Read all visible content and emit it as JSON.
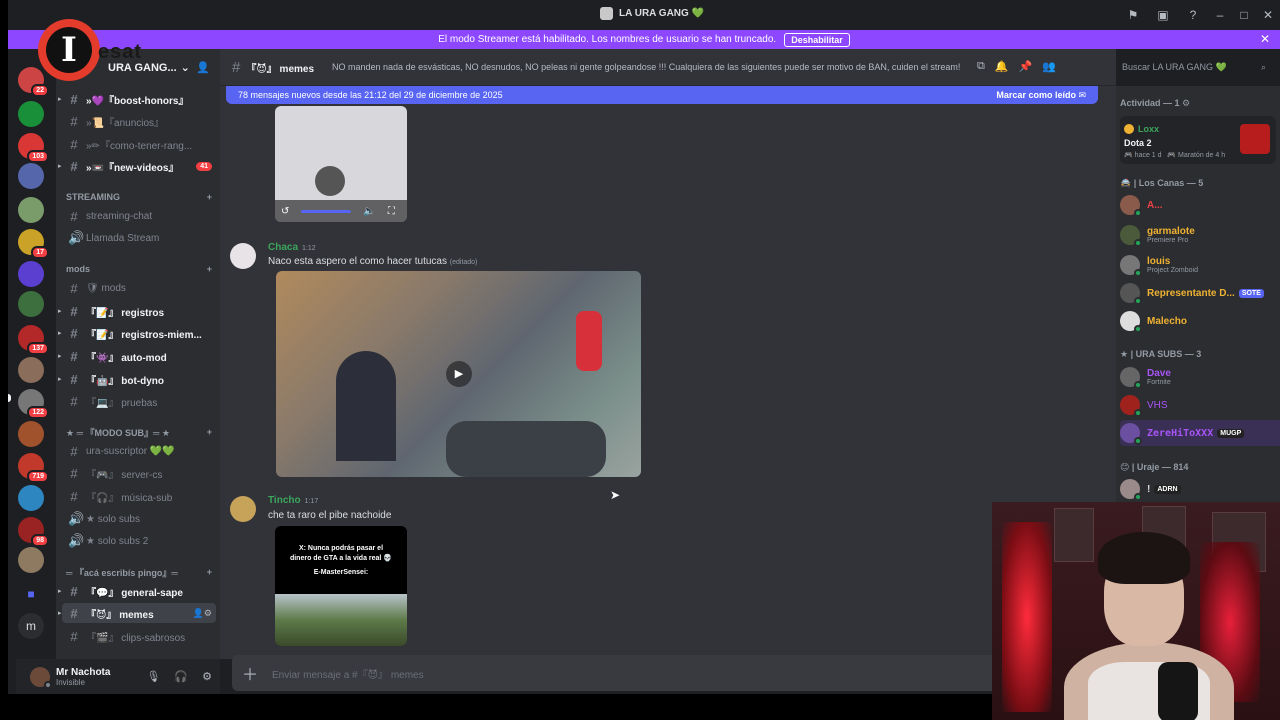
{
  "window": {
    "title": "LA URA GANG 💚"
  },
  "banner": {
    "text": "El modo Streamer está habilitado. Los nombres de usuario se han truncado.",
    "button": "Deshabilitar"
  },
  "rail": {
    "badges": [
      "22",
      "103",
      "17",
      "137",
      "122",
      "719",
      "98"
    ],
    "bottom_letter": "m"
  },
  "server": {
    "name": "URA GANG...",
    "logo_letter": "I",
    "logo_text": "esat"
  },
  "channels": [
    {
      "label": "»💜『boost-honors』",
      "state": "unread"
    },
    {
      "label": "»📜『anuncios』",
      "state": "normal"
    },
    {
      "label": "»✏『como-tener-rang...",
      "state": "normal"
    },
    {
      "label": "»📼『new-videos』",
      "state": "unread",
      "count": "41"
    }
  ],
  "categories": {
    "streaming": "STREAMING",
    "mods": "mods",
    "modo_sub": "★ ═ 『MODO SUB』═ ★",
    "aca": "═ 『acá escribís pingo』═"
  },
  "streaming_channels": [
    "streaming-chat",
    "Llamada Stream"
  ],
  "mods_channels": [
    {
      "label": "🛡 mods",
      "state": "normal"
    },
    {
      "label": "『📝』 registros",
      "state": "unread"
    },
    {
      "label": "『📝』 registros-miem...",
      "state": "unread"
    },
    {
      "label": "『👾』 auto-mod",
      "state": "unread"
    },
    {
      "label": "『🤖』 bot-dyno",
      "state": "unread"
    },
    {
      "label": "『💻』 pruebas",
      "state": "normal"
    }
  ],
  "sub_channels": [
    {
      "label": "ura-suscriptor 💚💚",
      "state": "normal"
    },
    {
      "label": "『🎮』 server-cs",
      "state": "normal"
    },
    {
      "label": "『🎧』 música-sub",
      "state": "normal"
    },
    {
      "label": "★ solo subs",
      "state": "normal"
    },
    {
      "label": "★ solo subs 2",
      "state": "normal"
    }
  ],
  "aca_channels": [
    {
      "label": "『💬』 general-sape",
      "state": "unread"
    },
    {
      "label": "『😈』 memes",
      "state": "active"
    },
    {
      "label": "『🎬』 clips-sabrosos",
      "state": "normal"
    }
  ],
  "user": {
    "name": "Mr Nachota",
    "status": "Invisible"
  },
  "channel_header": {
    "name": "『😈』 memes",
    "topic": "NO manden nada de esvásticas, NO desnudos, NO peleas ni gente golpeandose !!! Cualquiera de las siguientes puede ser motivo de BAN, cuiden el stream!"
  },
  "search": {
    "placeholder": "Buscar LA URA GANG 💚"
  },
  "new_messages": {
    "text": "78 mensajes nuevos desde las 21:12 del 29 de diciembre de 2025",
    "action": "Marcar como leído"
  },
  "messages": [
    {
      "author": "Chaca",
      "time": "1:12",
      "text": "Naco esta aspero el como hacer tutucas",
      "edited": "(editado)",
      "color": "#3ba55c"
    },
    {
      "author": "Tincho",
      "time": "1:17",
      "text": "che ta raro el pibe nachoide",
      "color": "#3ba55c"
    }
  ],
  "meme_caption": {
    "line1": "X: Nunca podrás pasar el",
    "line2": "dinero de GTA a la vida real 💀",
    "line3": "E-MasterSensei:"
  },
  "composer": {
    "placeholder": "Enviar mensaje a #『😈』 memes"
  },
  "members": {
    "activity_header": "Actividad — 1",
    "activity": {
      "name": "Loxx",
      "game": "Dota 2",
      "ago": "hace 1 d",
      "detail": "Maratón de 4 h"
    },
    "group1": "Los Canas — 5",
    "group1_members": [
      {
        "name": "A...",
        "activity": "",
        "color": "#ed4245"
      },
      {
        "name": "garmalote",
        "activity": "Premiere Pro",
        "color": "#f0b232"
      },
      {
        "name": "louis",
        "activity": "Project Zomboid",
        "color": "#f0b232"
      },
      {
        "name": "Representante D...",
        "activity": "",
        "color": "#f0b232",
        "tag": "SOTE"
      },
      {
        "name": "Malecho",
        "activity": "",
        "color": "#f0b232"
      }
    ],
    "group2": "URA SUBS — 3",
    "group2_members": [
      {
        "name": "Dave",
        "activity": "Fortnite",
        "color": "#a855f7"
      },
      {
        "name": "VHS",
        "activity": "",
        "color": "#a855f7"
      },
      {
        "name": "ZereHiToXXX",
        "activity": "",
        "color": "#a855f7",
        "tag": "MUGP"
      }
    ],
    "group3": "Uraje — 814",
    "group3_members": [
      {
        "name": "!",
        "activity": "",
        "color": "#dbdee1",
        "tag": "ADRN"
      }
    ]
  },
  "colors": {
    "banner": "#8c47ff",
    "blurple": "#5865f2",
    "online": "#23a55a",
    "mention": "#f23f43"
  }
}
